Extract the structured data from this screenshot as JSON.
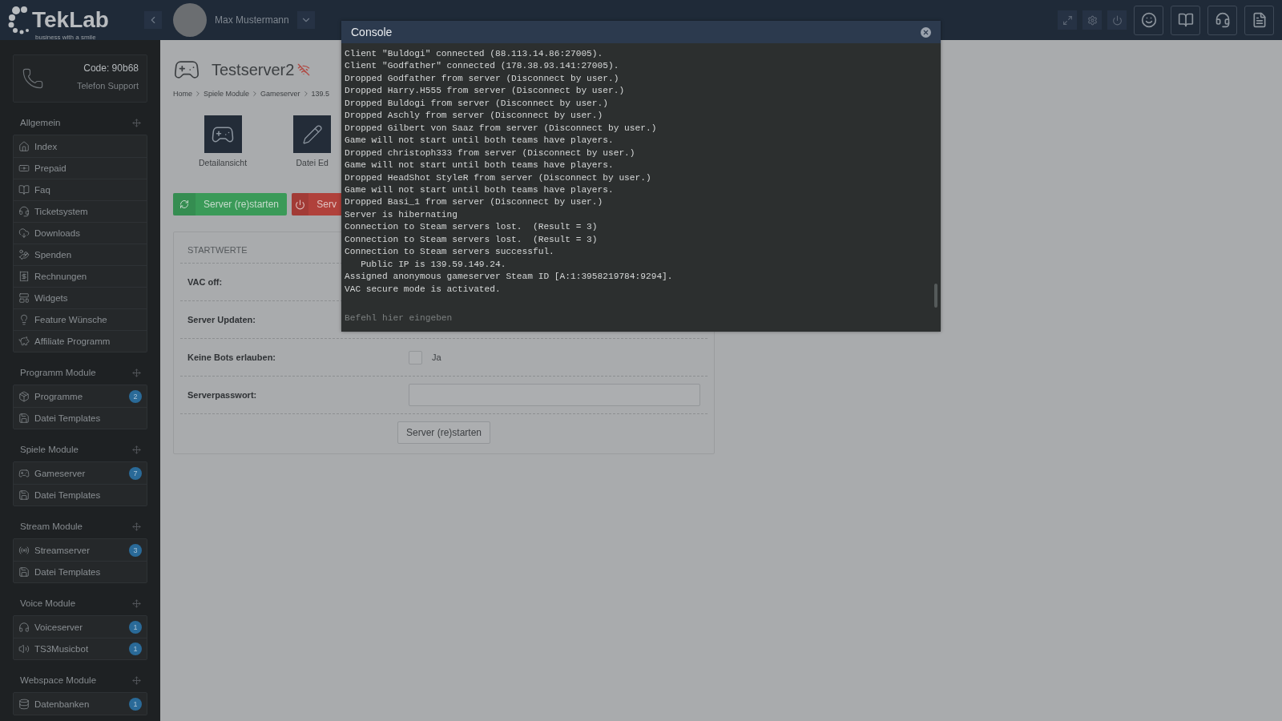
{
  "topbar": {
    "logo": "TekLab",
    "slogan": "business with a smile",
    "user": "Max Mustermann"
  },
  "support": {
    "code": "Code: 90b68",
    "label": "Telefon Support"
  },
  "sidebar": [
    {
      "title": "Allgemein",
      "items": [
        {
          "label": "Index"
        },
        {
          "label": "Prepaid"
        },
        {
          "label": "Faq"
        },
        {
          "label": "Ticketsystem"
        },
        {
          "label": "Downloads"
        },
        {
          "label": "Spenden"
        },
        {
          "label": "Rechnungen"
        },
        {
          "label": "Widgets"
        },
        {
          "label": "Feature Wünsche"
        },
        {
          "label": "Affiliate Programm"
        }
      ]
    },
    {
      "title": "Programm Module",
      "items": [
        {
          "label": "Programme",
          "badge": "2"
        },
        {
          "label": "Datei Templates"
        }
      ]
    },
    {
      "title": "Spiele Module",
      "items": [
        {
          "label": "Gameserver",
          "badge": "7"
        },
        {
          "label": "Datei Templates"
        }
      ]
    },
    {
      "title": "Stream Module",
      "items": [
        {
          "label": "Streamserver",
          "badge": "3"
        },
        {
          "label": "Datei Templates"
        }
      ]
    },
    {
      "title": "Voice Module",
      "items": [
        {
          "label": "Voiceserver",
          "badge": "1"
        },
        {
          "label": "TS3Musicbot",
          "badge": "1"
        }
      ]
    },
    {
      "title": "Webspace Module",
      "items": [
        {
          "label": "Datenbanken",
          "badge": "1"
        }
      ]
    }
  ],
  "page": {
    "title": "Testserver2",
    "breadcrumb": [
      "Home",
      "Spiele Module",
      "Gameserver",
      "139.5"
    ],
    "tiles": [
      "Detailansicht",
      "Datei Ed"
    ],
    "actions": [
      {
        "label": "Server (re)starten",
        "kind": "restart"
      },
      {
        "label": "Serv",
        "kind": "stop"
      }
    ],
    "panel": {
      "heading": "STARTWERTE",
      "rows": [
        {
          "label": "VAC off:",
          "kind": "hidden"
        },
        {
          "label": "Server Updaten:",
          "kind": "hidden"
        },
        {
          "label": "Keine Bots erlauben:",
          "kind": "checkbox",
          "checked": false,
          "option": "Ja"
        },
        {
          "label": "Serverpasswort:",
          "kind": "text"
        }
      ],
      "submit": "Server (re)starten"
    }
  },
  "console": {
    "title": "Console",
    "placeholder": "Befehl hier eingeben",
    "lines": [
      "Client \"Buldogi\" connected (88.113.14.86:27005).",
      "Client \"Godfather\" connected (178.38.93.141:27005).",
      "Dropped Godfather from server (Disconnect by user.)",
      "Dropped Harry.H555 from server (Disconnect by user.)",
      "Dropped Buldogi from server (Disconnect by user.)",
      "Dropped Aschly from server (Disconnect by user.)",
      "Dropped Gilbert von Saaz from server (Disconnect by user.)",
      "Game will not start until both teams have players.",
      "Dropped christoph333 from server (Disconnect by user.)",
      "Game will not start until both teams have players.",
      "Dropped HeadShot StyleR from server (Disconnect by user.)",
      "Game will not start until both teams have players.",
      "Dropped Basi_1 from server (Disconnect by user.)",
      "Server is hibernating",
      "Connection to Steam servers lost.  (Result = 3)",
      "Connection to Steam servers lost.  (Result = 3)",
      "Connection to Steam servers successful.",
      "   Public IP is 139.59.149.24.",
      "Assigned anonymous gameserver Steam ID [A:1:3958219784:9294].",
      "VAC secure mode is activated."
    ]
  }
}
